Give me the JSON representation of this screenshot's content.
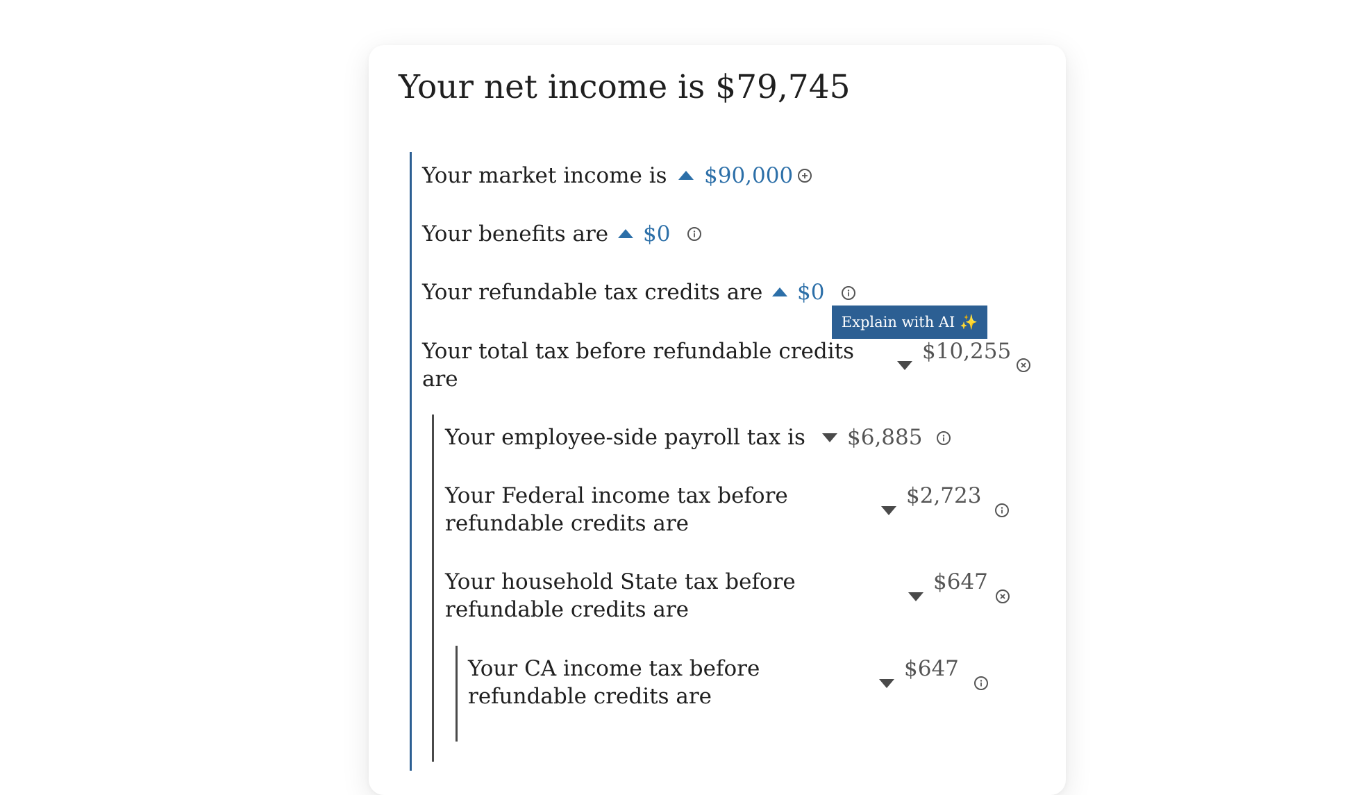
{
  "header": {
    "title": "Your net income is $79,745"
  },
  "rows": {
    "market_income": {
      "label": "Your market income is",
      "value": "$90,000",
      "direction": "up",
      "icon": "plus-circle-icon"
    },
    "benefits": {
      "label": "Your benefits are",
      "value": "$0",
      "direction": "up",
      "icon": "info-icon"
    },
    "refundable_credits": {
      "label": "Your refundable tax credits are",
      "value": "$0",
      "direction": "up",
      "icon": "info-icon"
    },
    "total_tax": {
      "label": "Your total tax before refundable credits are",
      "value": "$10,255",
      "direction": "down",
      "icon": "close-circle-icon"
    },
    "payroll_tax": {
      "label": "Your employee-side payroll tax is",
      "value": "$6,885",
      "direction": "down",
      "icon": "info-icon"
    },
    "federal_tax": {
      "label": "Your Federal income tax before refundable credits are",
      "value": "$2,723",
      "direction": "down",
      "icon": "info-icon"
    },
    "state_tax": {
      "label": "Your household State tax before refundable credits are",
      "value": "$647",
      "direction": "down",
      "icon": "close-circle-icon"
    },
    "ca_tax": {
      "label": "Your CA income tax before refundable credits are",
      "value": "$647",
      "direction": "down",
      "icon": "info-icon"
    }
  },
  "tooltip": {
    "label": "Explain with AI ✨"
  },
  "colors": {
    "accent_blue": "#2c5f93",
    "value_blue": "#2c6fa8",
    "value_gray": "#555555",
    "text": "#1f1f1f"
  }
}
